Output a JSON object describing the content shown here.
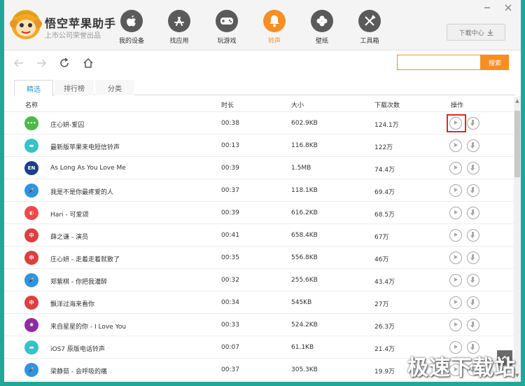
{
  "brand": {
    "title": "悟空苹果助手",
    "subtitle": "上市公司荣誉出品"
  },
  "nav": [
    {
      "label": "我的设备",
      "icon": "apple-icon",
      "active": false
    },
    {
      "label": "找应用",
      "icon": "app-store-icon",
      "active": false
    },
    {
      "label": "玩游戏",
      "icon": "gamepad-icon",
      "active": false
    },
    {
      "label": "铃声",
      "icon": "bell-icon",
      "active": true
    },
    {
      "label": "壁纸",
      "icon": "clover-icon",
      "active": false
    },
    {
      "label": "工具箱",
      "icon": "tools-icon",
      "active": false
    }
  ],
  "download_center": {
    "label": "下載中心"
  },
  "search": {
    "placeholder": "",
    "button": "搜索"
  },
  "tabs": [
    {
      "label": "精选",
      "active": true
    },
    {
      "label": "排行榜",
      "active": false
    },
    {
      "label": "分类",
      "active": false
    }
  ],
  "columns": {
    "name": "名称",
    "duration": "时长",
    "size": "大小",
    "downloads": "下载次数",
    "actions": "操作"
  },
  "rows": [
    {
      "icon": "chat-dots-icon",
      "icon_text": "•••",
      "color": "#4cb848",
      "name": "庄心妍-爱囚",
      "duration": "00:38",
      "size": "602.9KB",
      "downloads": "124.1万"
    },
    {
      "icon": "message-icon",
      "icon_text": "▬",
      "color": "#38c1c9",
      "name": "最新版苹果来电短信铃声",
      "duration": "00:13",
      "size": "116.8KB",
      "downloads": "122万"
    },
    {
      "icon": "english-badge-icon",
      "icon_text": "EN",
      "color": "#1c3f8a",
      "name": "As Long As You Love Me",
      "duration": "00:39",
      "size": "1.5MB",
      "downloads": "74.4万"
    },
    {
      "icon": "microphone-icon",
      "icon_text": "🎤",
      "color": "#2f93e0",
      "name": "我是不是你最疼爱的人",
      "duration": "00:37",
      "size": "118.1KB",
      "downloads": "69.4万"
    },
    {
      "icon": "pokeball-icon",
      "icon_text": "◐",
      "color": "#ea4a4a",
      "name": "Hari - 可爱颂",
      "duration": "00:39",
      "size": "616.2KB",
      "downloads": "68.5万"
    },
    {
      "icon": "chinese-badge-icon",
      "icon_text": "中",
      "color": "#d94140",
      "name": "薛之谦 - 演员",
      "duration": "00:41",
      "size": "658.4KB",
      "downloads": "67万"
    },
    {
      "icon": "chinese-badge-icon",
      "icon_text": "中",
      "color": "#d94140",
      "name": "庄心妍 - 走着走着就散了",
      "duration": "00:35",
      "size": "556.8KB",
      "downloads": "46万"
    },
    {
      "icon": "microphone-icon",
      "icon_text": "🎤",
      "color": "#2f93e0",
      "name": "郑紫棋 - 你把我灌醉",
      "duration": "00:32",
      "size": "255.6KB",
      "downloads": "43.4万"
    },
    {
      "icon": "chinese-badge-icon",
      "icon_text": "中",
      "color": "#d94140",
      "name": "飘洋过海来看你",
      "duration": "00:34",
      "size": "545KB",
      "downloads": "27万"
    },
    {
      "icon": "film-reel-icon",
      "icon_text": "✺",
      "color": "#8b2fa0",
      "name": "来自星星的你 - I Love You",
      "duration": "00:33",
      "size": "524.2KB",
      "downloads": "26.3万"
    },
    {
      "icon": "message-icon",
      "icon_text": "▬",
      "color": "#38c1c9",
      "name": "iOS7 原版电话铃声",
      "duration": "00:07",
      "size": "61.1KB",
      "downloads": "21.4万"
    },
    {
      "icon": "microphone-icon",
      "icon_text": "🎤",
      "color": "#2f93e0",
      "name": "梁静茹 - 会呼吸的痛",
      "duration": "00:37",
      "size": "305.3KB",
      "downloads": "19.9万"
    }
  ],
  "watermark": "极速下载站"
}
